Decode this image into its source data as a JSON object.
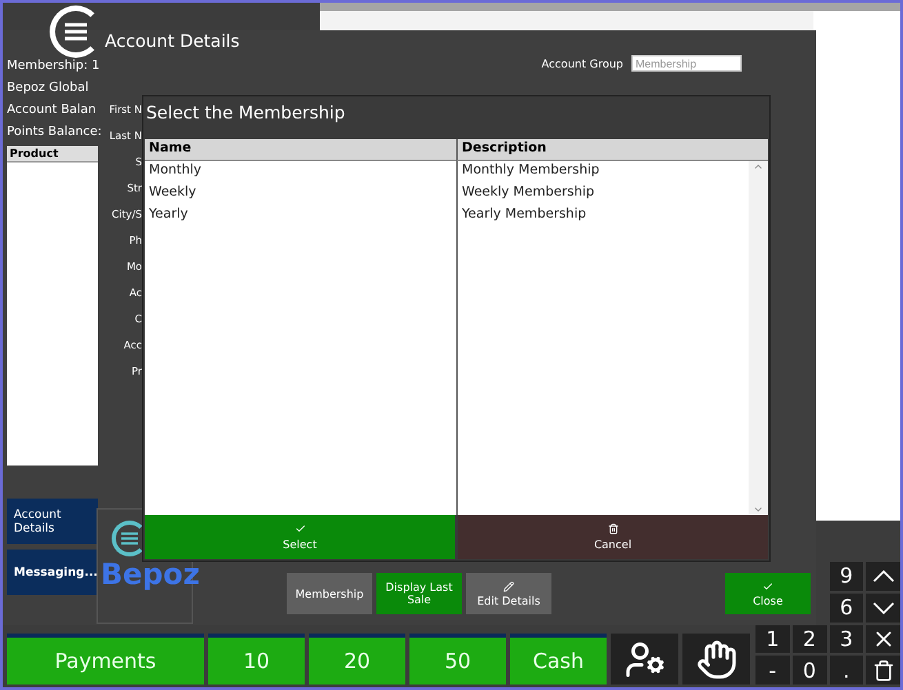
{
  "account_window": {
    "title": "Account Details"
  },
  "account_summary": [
    "Membership: 1",
    "Bepoz Global",
    "Account Balan",
    "Points Balance:"
  ],
  "product_table": {
    "columns": [
      "Product"
    ]
  },
  "form_labels": [
    "First N",
    "Last N",
    "S",
    "Str",
    "City/S",
    "Ph",
    "Mo",
    "Ac",
    "C",
    "Acc",
    "Pr"
  ],
  "account_group": {
    "label": "Account Group",
    "value": "Membership"
  },
  "dialog": {
    "title": "Select the Membership",
    "columns": [
      "Name",
      "Description"
    ],
    "rows": [
      {
        "name": "Monthly",
        "description": "Monthly Membership"
      },
      {
        "name": "Weekly",
        "description": "Weekly Membership"
      },
      {
        "name": "Yearly",
        "description": "Yearly Membership"
      }
    ],
    "buttons": [
      {
        "label": "Select",
        "kind": "select"
      },
      {
        "label": "Cancel",
        "kind": "cancel"
      }
    ]
  },
  "side_buttons": [
    "Account Details",
    "Messaging..."
  ],
  "logo": {
    "text": "Bepoz"
  },
  "action_buttons": [
    {
      "label": "Membership",
      "kind": "plain"
    },
    {
      "label": "Display Last Sale",
      "kind": "green"
    },
    {
      "label": "Edit Details",
      "kind": "edit"
    }
  ],
  "close_button": {
    "label": "Close"
  },
  "bottom_buttons": [
    "Payments",
    "10",
    "20",
    "50",
    "Cash"
  ],
  "numpad": [
    {
      "kind": "blank"
    },
    {
      "kind": "blank"
    },
    {
      "kind": "text",
      "label": "9"
    },
    {
      "kind": "up"
    },
    {
      "kind": "blank"
    },
    {
      "kind": "blank"
    },
    {
      "kind": "text",
      "label": "6"
    },
    {
      "kind": "down"
    },
    {
      "kind": "text",
      "label": "1"
    },
    {
      "kind": "text",
      "label": "2"
    },
    {
      "kind": "text",
      "label": "3"
    },
    {
      "kind": "clear"
    },
    {
      "kind": "text",
      "label": "-"
    },
    {
      "kind": "text",
      "label": "0"
    },
    {
      "kind": "text",
      "label": "."
    },
    {
      "kind": "delete"
    }
  ]
}
